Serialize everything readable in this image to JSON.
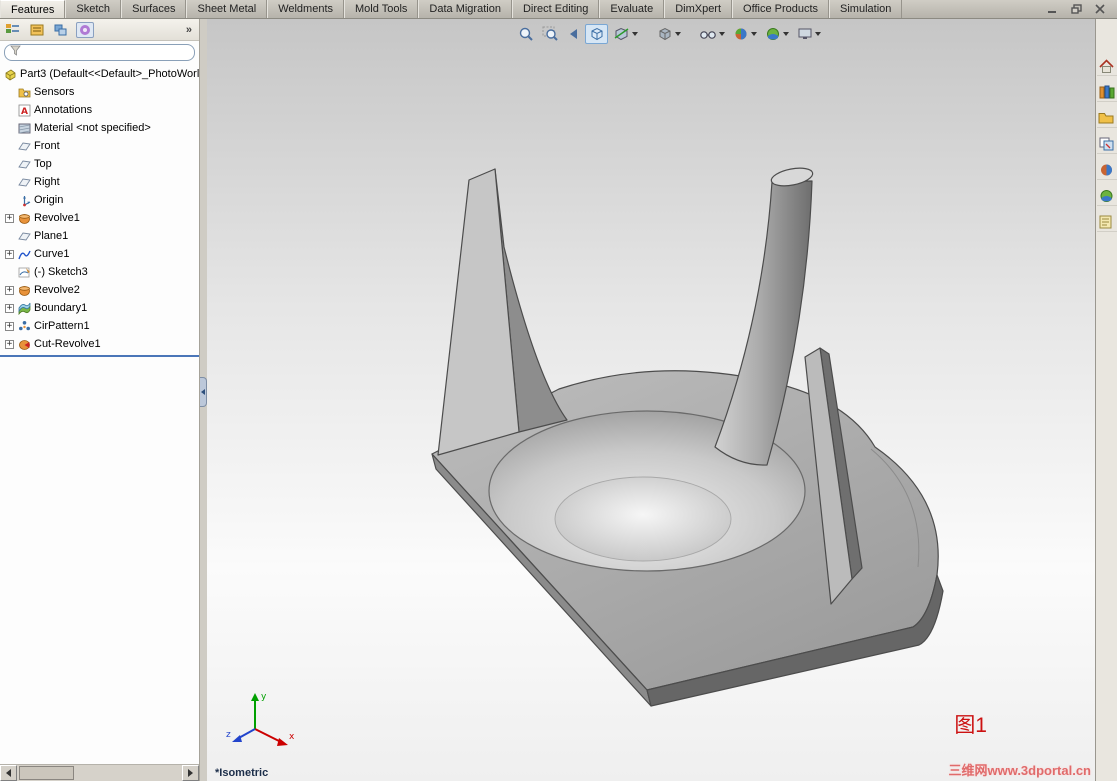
{
  "command_tabs": {
    "items": [
      {
        "label": "Features",
        "active": true
      },
      {
        "label": "Sketch",
        "active": false
      },
      {
        "label": "Surfaces",
        "active": false
      },
      {
        "label": "Sheet Metal",
        "active": false
      },
      {
        "label": "Weldments",
        "active": false
      },
      {
        "label": "Mold Tools",
        "active": false
      },
      {
        "label": "Data Migration",
        "active": false
      },
      {
        "label": "Direct Editing",
        "active": false
      },
      {
        "label": "Evaluate",
        "active": false
      },
      {
        "label": "DimXpert",
        "active": false
      },
      {
        "label": "Office Products",
        "active": false
      },
      {
        "label": "Simulation",
        "active": false
      }
    ]
  },
  "window_controls": {
    "icons": [
      "minimize-icon",
      "restore-icon",
      "close-icon"
    ]
  },
  "panel_toolbar": {
    "icons": [
      "featuremanager-tree-tab-icon",
      "propertymanager-tab-icon",
      "configurationmanager-tab-icon",
      "dimxpertmanager-tab-icon"
    ],
    "overflow_glyph": "»"
  },
  "feature_tree": {
    "expander_glyph": "+",
    "filter": {
      "value": "",
      "icon": "filter-funnel-icon"
    },
    "root_label": "Part3 (Default<<Default>_PhotoWorl",
    "items": [
      {
        "label": "Sensors",
        "icon": "sensors-folder-icon",
        "expander": false
      },
      {
        "label": "Annotations",
        "icon": "annotations-icon",
        "expander": false
      },
      {
        "label": "Material <not specified>",
        "icon": "material-icon",
        "expander": false
      },
      {
        "label": "Front",
        "icon": "plane-icon",
        "expander": false
      },
      {
        "label": "Top",
        "icon": "plane-icon",
        "expander": false
      },
      {
        "label": "Right",
        "icon": "plane-icon",
        "expander": false
      },
      {
        "label": "Origin",
        "icon": "origin-icon",
        "expander": false
      },
      {
        "label": "Revolve1",
        "icon": "revolve-icon",
        "expander": true
      },
      {
        "label": "Plane1",
        "icon": "plane-icon",
        "expander": false
      },
      {
        "label": "Curve1",
        "icon": "curve-icon",
        "expander": true
      },
      {
        "label": "(-) Sketch3",
        "icon": "sketch-icon",
        "expander": false
      },
      {
        "label": "Revolve2",
        "icon": "revolve-icon",
        "expander": true
      },
      {
        "label": "Boundary1",
        "icon": "boundary-icon",
        "expander": true
      },
      {
        "label": "CirPattern1",
        "icon": "cirpattern-icon",
        "expander": true
      },
      {
        "label": "Cut-Revolve1",
        "icon": "cut-revolve-icon",
        "expander": true
      }
    ]
  },
  "heads_up_toolbar": {
    "icons": [
      "zoom-fit-icon",
      "zoom-to-area-icon",
      "previous-view-icon",
      "section-view-icon",
      "view-orientation-icon",
      "display-style-icon",
      "hide-show-items-icon",
      "edit-appearance-icon",
      "apply-scene-icon",
      "view-settings-icon"
    ],
    "active": "view-orientation-icon"
  },
  "task_pane": {
    "icons": [
      "home-icon",
      "design-library-icon",
      "file-explorer-icon",
      "view-palette-icon",
      "appearances-icon",
      "scenes-icon",
      "custom-properties-icon"
    ]
  },
  "viewport": {
    "view_label": "*Isometric",
    "figure_label": "图1",
    "watermark": "三维网www.3dportal.cn",
    "triad_labels": {
      "x": "x",
      "y": "y",
      "z": "z"
    }
  },
  "colors": {
    "accent_blue": "#3a6ea5",
    "tree_splitter_blue": "#4a76b8",
    "figure_red": "#cc1111",
    "watermark_red": "#e06b6b",
    "model_gray": "#ababab"
  }
}
